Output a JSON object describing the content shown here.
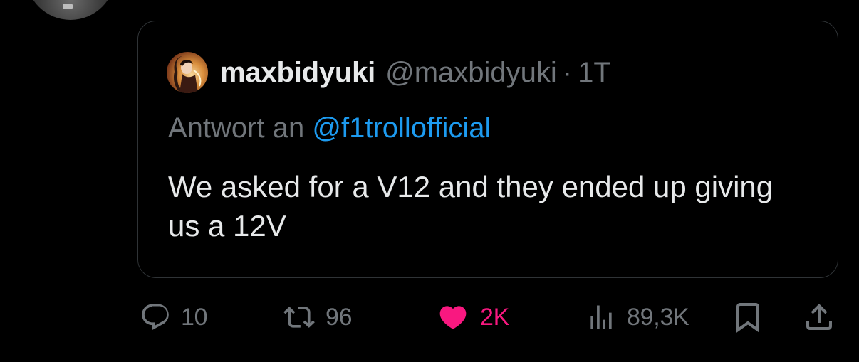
{
  "quoted_tweet": {
    "display_name": "maxbidyuki",
    "handle": "@maxbidyuki",
    "separator": "·",
    "time": "1T",
    "reply_prefix": "Antwort an",
    "reply_to": "@f1trollofficial",
    "text": "We asked for a V12 and they ended up giving us a 12V"
  },
  "actions": {
    "replies": "10",
    "reposts": "96",
    "likes": "2K",
    "views": "89,3K"
  },
  "icons": {
    "reply": "speech-bubble-icon",
    "repost": "repost-arrows-icon",
    "like": "heart-icon",
    "views": "bar-chart-icon",
    "bookmark": "bookmark-icon",
    "share": "share-upload-icon"
  },
  "colors": {
    "background": "#000000",
    "text_primary": "#e7e9ea",
    "text_secondary": "#71767b",
    "mention": "#1d9bf0",
    "like_active": "#f91880",
    "card_border": "#2f3336"
  }
}
